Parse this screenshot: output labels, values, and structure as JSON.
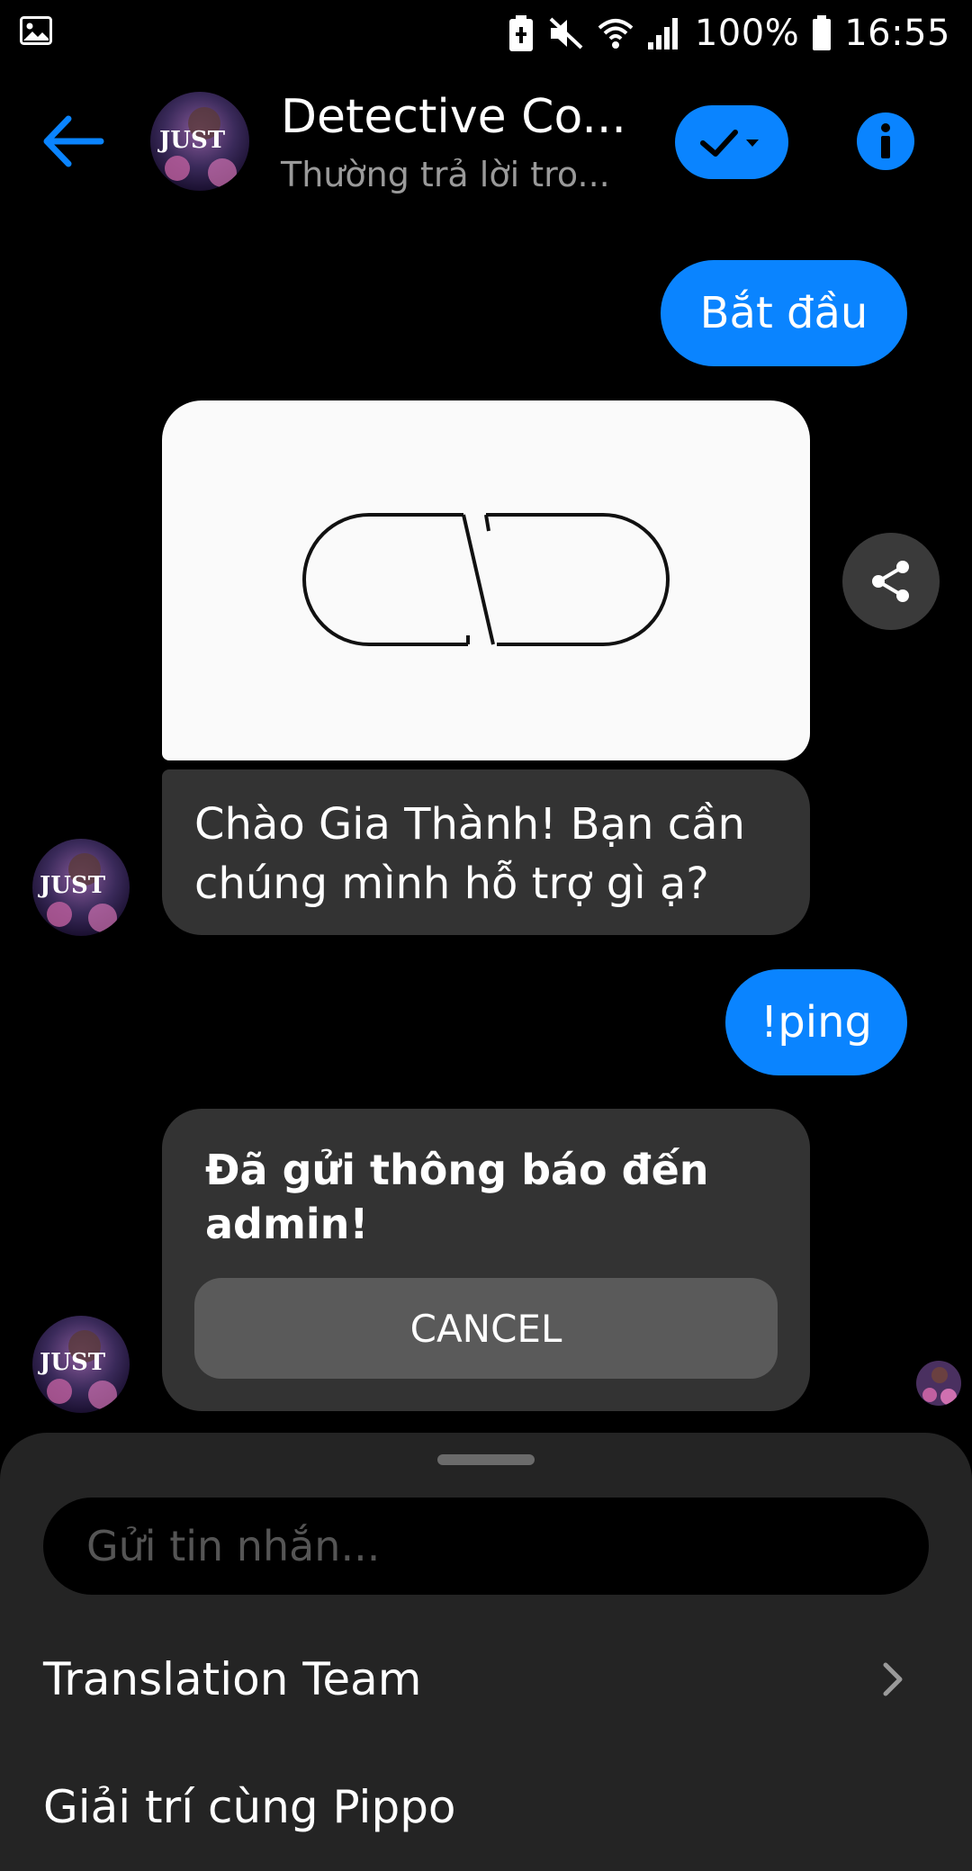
{
  "status_bar": {
    "battery_percent": "100%",
    "time": "16:55"
  },
  "header": {
    "title": "Detective Co...",
    "subtitle": "Thường trả lời tro..."
  },
  "messages": {
    "outgoing_start": "Bắt đầu",
    "incoming_greeting": "Chào Gia Thành! Bạn cần chúng mình hỗ trợ gì ạ?",
    "outgoing_ping": "!ping",
    "incoming_notice": "Đã gửi thông báo đến admin!",
    "cancel_label": "CANCEL"
  },
  "composer": {
    "placeholder": "Gửi tin nhắn..."
  },
  "menu": {
    "items": [
      {
        "label": "Translation Team"
      },
      {
        "label": "Giải trí cùng Pippo"
      }
    ]
  },
  "colors": {
    "accent": "#0a84ff",
    "incoming_bubble": "#333333",
    "sheet": "#242424"
  }
}
